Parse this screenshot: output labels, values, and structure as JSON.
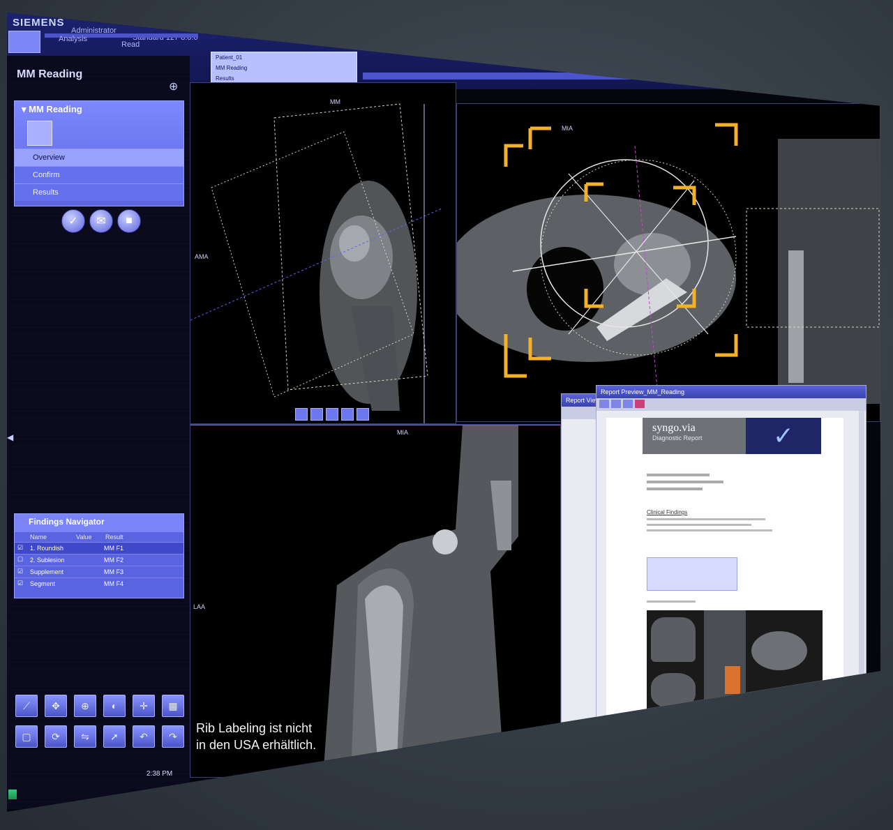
{
  "topbar": {
    "brand": "SIEMENS",
    "user": "Administrator",
    "patient": "Standard 127 8.0.0",
    "tabs": [
      "Analysis",
      "Read"
    ],
    "worklist_rows": [
      "Patient_01",
      "MM Reading",
      "Results"
    ]
  },
  "left_panel": {
    "title": "MM Reading",
    "workflow": {
      "header": "MM Reading",
      "steps": [
        "Overview",
        "Confirm",
        "Results"
      ]
    },
    "action_icons": [
      "check-icon",
      "mail-icon",
      "stop-icon"
    ],
    "findings_navigator": {
      "title": "Findings Navigator",
      "columns": [
        "Name",
        "Value",
        "Result"
      ],
      "rows": [
        {
          "name": "1. Roundish",
          "value": "MM F1",
          "checked": true,
          "selected": true
        },
        {
          "name": "2. Sublesion",
          "value": "MM F2",
          "checked": false,
          "selected": false
        },
        {
          "name": "Supplement",
          "value": "MM F3",
          "checked": true,
          "selected": false
        },
        {
          "name": "Segment",
          "value": "MM F4",
          "checked": true,
          "selected": false
        }
      ]
    },
    "tools_row1": [
      "ruler-icon",
      "pan-icon",
      "zoom-icon",
      "window-level-icon",
      "crosshair-icon",
      "layout-icon"
    ],
    "tools_row2": [
      "select-icon",
      "rotate-icon",
      "flip-icon",
      "arrow-icon",
      "undo-icon",
      "redo-icon"
    ],
    "clock": "2:38 PM"
  },
  "viewports": {
    "top_left_label": "MM",
    "top_left_side": "AMA",
    "top_right_label": "MIA",
    "bottom_label": "MIA",
    "bottom_side": "LAA",
    "caption_line1": "Rib Labeling ist nicht",
    "caption_line2": "in den USA erhältlich."
  },
  "report": {
    "back_title": "Report View",
    "title": "Report Preview_MM_Reading",
    "product": "syngo.via",
    "subtitle": "Diagnostic Report",
    "section": "Clinical Findings",
    "colors": {
      "accent": "#4b55c9",
      "brand_dark": "#1d2270",
      "highlight": "#f2b12a"
    }
  }
}
